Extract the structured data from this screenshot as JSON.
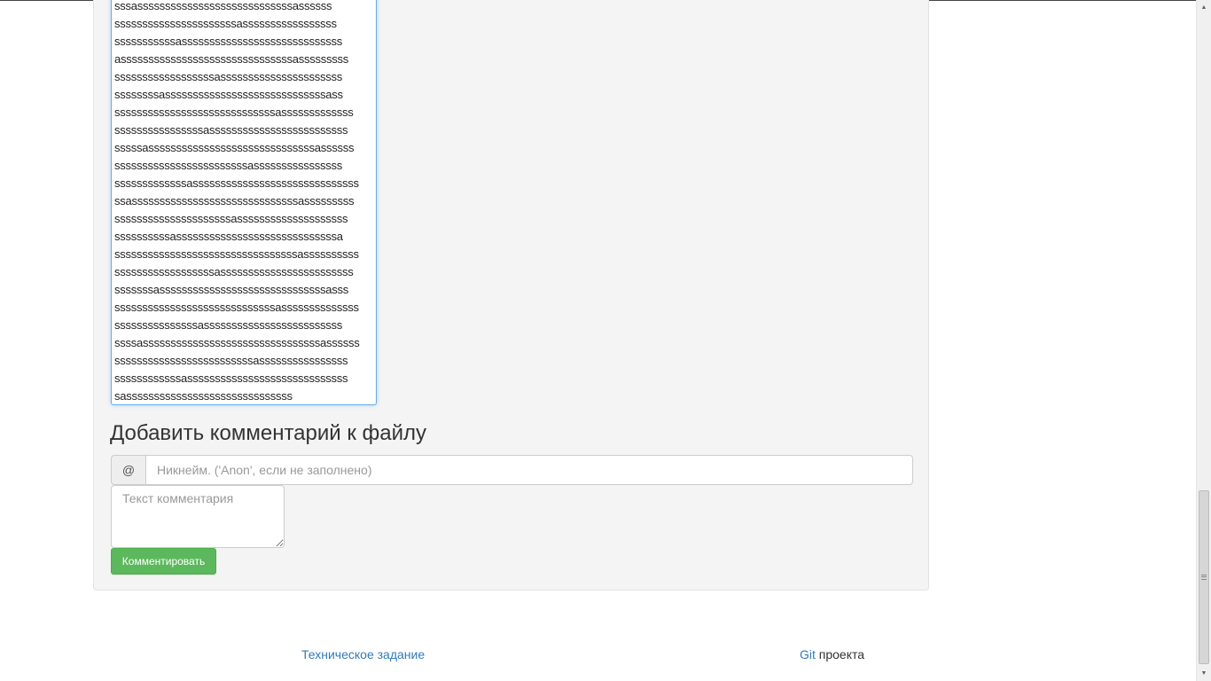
{
  "file_view": {
    "lines": [
      "sssassssssssssssssssssssssssssssassssss",
      "ssssssssssssssssssssssasssssssssssssssss",
      "sssssssssssasssssssssssssssssssssssssssss",
      "asssssssssssssssssssssssssssssssasssssssss",
      "ssssssssssssssssssassssssssssssssssssssss",
      "ssssssssasssssssssssssssssssssssssssssass",
      "sssssssssssssssssssssssssssssasssssssssssss",
      "ssssssssssssssssasssssssssssssssssssssssss",
      "sssssassssssssssssssssssssssssssssssassssss",
      "ssssssssssssssssssssssssassssssssssssssss",
      "sssssssssssssassssssssssssssssssssssssssssss",
      "ssassssssssssssssssssssssssssssssasssssssss",
      "sssssssssssssssssssssassssssssssssssssssss",
      "ssssssssssasssssssssssssssssssssssssssssa",
      "sssssssssssssssssssssssssssssssssassssssssss",
      "ssssssssssssssssssassssssssssssssssssssssss",
      "sssssssassssssssssssssssssssssssssssssasss",
      "sssssssssssssssssssssssssssssassssssssssssss",
      "sssssssssssssssasssssssssssssssssssssssss",
      "ssssassssssssssssssssssssssssssssssssassssss",
      "sssssssssssssssssssssssssassssssssssssssss",
      "ssssssssssssasssssssssssssssssssssssssssss",
      "sassssssssssssssssssssssssssssss"
    ]
  },
  "comment_form": {
    "title": "Добавить комментарий к файлу",
    "nick_addon": "@",
    "nick_placeholder": "Никнейм. ('Anon', если не заполнено)",
    "text_placeholder": "Текст комментария",
    "submit_label": "Комментировать"
  },
  "footer": {
    "spec_link": "Техническое задание",
    "git_link": "Git",
    "git_suffix": " проекта"
  },
  "colors": {
    "link": "#337ab7",
    "success": "#5cb85c",
    "well_bg": "#f4f4f4"
  }
}
